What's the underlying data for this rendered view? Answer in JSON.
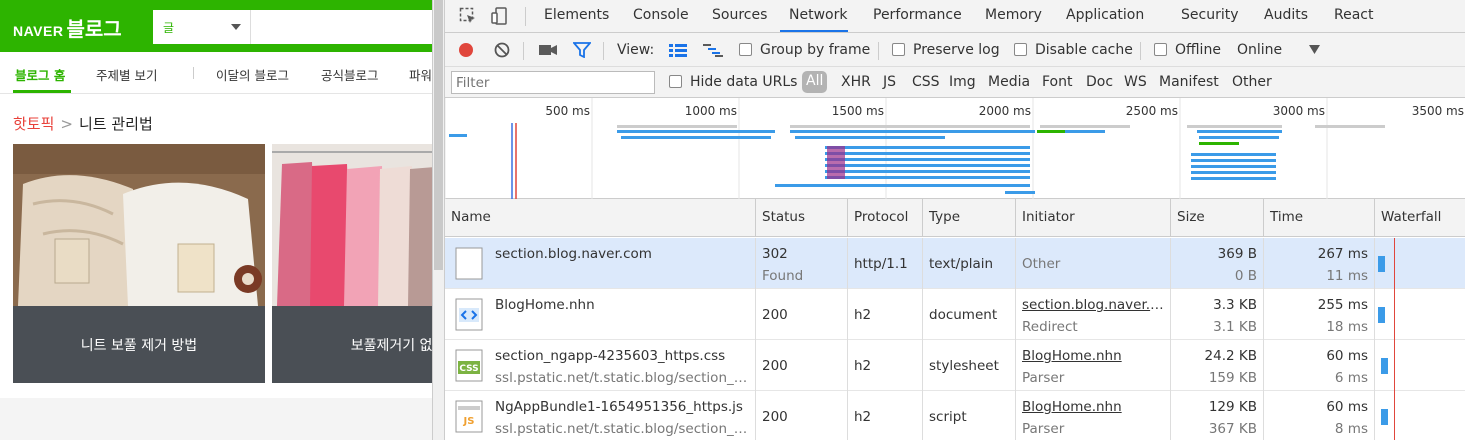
{
  "blog": {
    "logo_naver": "NAVER",
    "logo_blog": "블로그",
    "search_select": "글",
    "nav": [
      "블로그 홈",
      "주제별 보기",
      "이달의 블로그",
      "공식블로그",
      "파워"
    ],
    "crumb_hot": "핫토픽",
    "crumb_arrow": ">",
    "crumb_topic": "니트 관리법",
    "cards": [
      {
        "caption": "니트 보풀 제거 방법"
      },
      {
        "caption": "보풀제거기 없이"
      }
    ]
  },
  "devtools": {
    "tabs": [
      "Elements",
      "Console",
      "Sources",
      "Network",
      "Performance",
      "Memory",
      "Application",
      "Security",
      "Audits",
      "React"
    ],
    "active_tab": "Network",
    "toolbar": {
      "view_label": "View:",
      "group_by_frame": "Group by frame",
      "preserve_log": "Preserve log",
      "disable_cache": "Disable cache",
      "offline": "Offline",
      "throttle": "Online"
    },
    "filter": {
      "placeholder": "Filter",
      "hide_data_urls": "Hide data URLs",
      "types": [
        "All",
        "XHR",
        "JS",
        "CSS",
        "Img",
        "Media",
        "Font",
        "Doc",
        "WS",
        "Manifest",
        "Other"
      ]
    },
    "timeline_ticks": [
      "500 ms",
      "1000 ms",
      "1500 ms",
      "2000 ms",
      "2500 ms",
      "3000 ms",
      "3500 ms"
    ],
    "columns": [
      "Name",
      "Status",
      "Protocol",
      "Type",
      "Initiator",
      "Size",
      "Time",
      "Waterfall"
    ],
    "rows": [
      {
        "name": "section.blog.naver.com",
        "path": "",
        "status": "302",
        "status_text": "Found",
        "protocol": "http/1.1",
        "type": "text/plain",
        "initiator": "Other",
        "initiator_sub": "",
        "size": "369 B",
        "size_sub": "0 B",
        "time": "267 ms",
        "time_sub": "11 ms",
        "icon": "blank-file-icon"
      },
      {
        "name": "BlogHome.nhn",
        "path": "",
        "status": "200",
        "status_text": "",
        "protocol": "h2",
        "type": "document",
        "initiator": "section.blog.naver.com",
        "initiator_sub": "Redirect",
        "size": "3.3 KB",
        "size_sub": "3.1 KB",
        "time": "255 ms",
        "time_sub": "18 ms",
        "icon": "html-file-icon"
      },
      {
        "name": "section_ngapp-4235603_https.css",
        "path": "ssl.pstatic.net/t.static.blog/section_ngapp",
        "status": "200",
        "status_text": "",
        "protocol": "h2",
        "type": "stylesheet",
        "initiator": "BlogHome.nhn",
        "initiator_sub": "Parser",
        "size": "24.2 KB",
        "size_sub": "159 KB",
        "time": "60 ms",
        "time_sub": "6 ms",
        "icon": "css-file-icon"
      },
      {
        "name": "NgAppBundle1-1654951356_https.js",
        "path": "ssl.pstatic.net/t.static.blog/section_ngapp",
        "status": "200",
        "status_text": "",
        "protocol": "h2",
        "type": "script",
        "initiator": "BlogHome.nhn",
        "initiator_sub": "Parser",
        "size": "129 KB",
        "size_sub": "367 KB",
        "time": "60 ms",
        "time_sub": "8 ms",
        "icon": "js-file-icon"
      }
    ]
  },
  "colors": {
    "naver_green": "#2db400",
    "record_red": "#e0463c",
    "filter_blue": "#1a73e8",
    "bar_blue": "#3b9be8"
  }
}
